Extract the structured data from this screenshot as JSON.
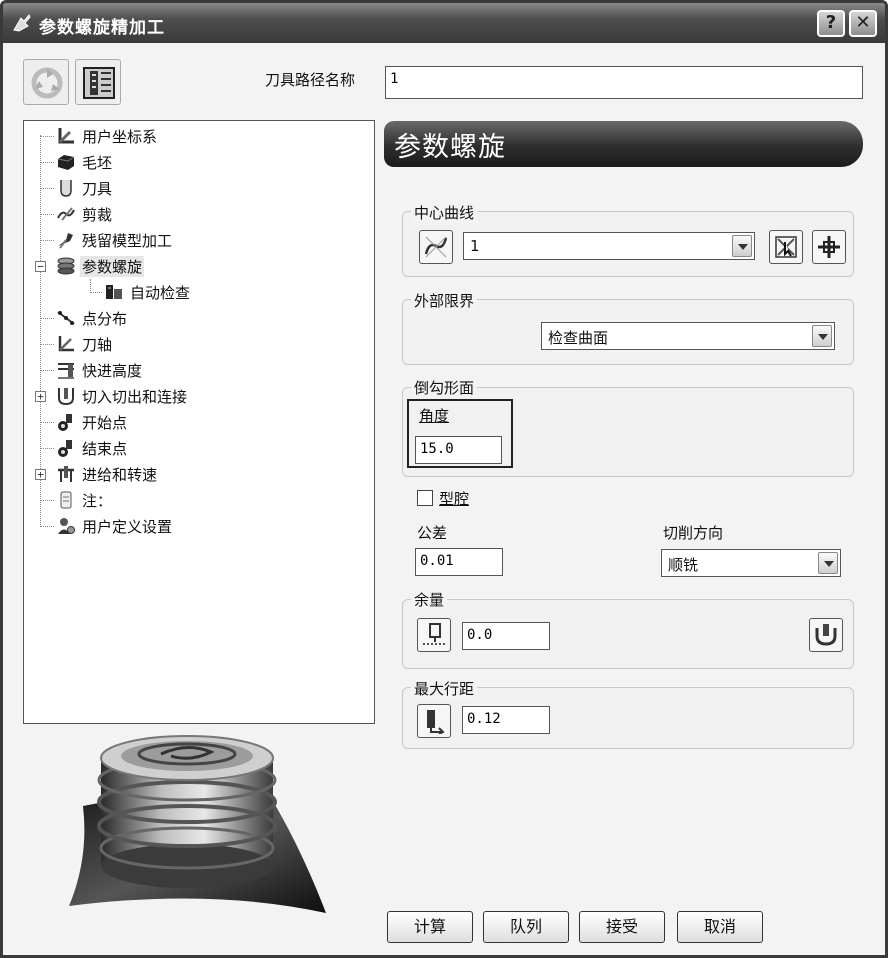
{
  "window": {
    "title": "参数螺旋精加工",
    "help_label": "?",
    "close_label": "✕"
  },
  "toolpath_name": {
    "label": "刀具路径名称",
    "value": "1"
  },
  "tree": {
    "items": [
      {
        "label": "用户坐标系",
        "icon": "ucs-icon"
      },
      {
        "label": "毛坯",
        "icon": "block-icon"
      },
      {
        "label": "刀具",
        "icon": "tool-icon"
      },
      {
        "label": "剪裁",
        "icon": "trim-icon"
      },
      {
        "label": "残留模型加工",
        "icon": "rest-model-icon"
      },
      {
        "label": "参数螺旋",
        "icon": "spiral-icon",
        "selected": true,
        "expander": "−"
      },
      {
        "label": "自动检查",
        "icon": "auto-check-icon"
      },
      {
        "label": "点分布",
        "icon": "point-distribution-icon"
      },
      {
        "label": "刀轴",
        "icon": "tool-axis-icon"
      },
      {
        "label": "快进高度",
        "icon": "rapid-height-icon"
      },
      {
        "label": "切入切出和连接",
        "icon": "leads-links-icon",
        "expander": "+"
      },
      {
        "label": "开始点",
        "icon": "start-point-icon"
      },
      {
        "label": "结束点",
        "icon": "end-point-icon"
      },
      {
        "label": "进给和转速",
        "icon": "feeds-speeds-icon",
        "expander": "+"
      },
      {
        "label": "注：",
        "icon": "notes-icon"
      },
      {
        "label": "用户定义设置",
        "icon": "user-settings-icon"
      }
    ]
  },
  "panel": {
    "title": "参数螺旋",
    "center_curve": {
      "title": "中心曲线",
      "value": "1"
    },
    "outer_limit": {
      "title": "外部限界",
      "value": "检查曲面"
    },
    "undercut": {
      "title": "倒勾形面",
      "angle_label": "角度",
      "angle_value": "15.0"
    },
    "pocket": {
      "label": "型腔",
      "checked": false
    },
    "tolerance": {
      "label": "公差",
      "value": "0.01"
    },
    "cut_direction": {
      "label": "切削方向",
      "value": "顺铣"
    },
    "thickness": {
      "title": "余量",
      "value": "0.0"
    },
    "stepover": {
      "title": "最大行距",
      "value": "0.12"
    }
  },
  "buttons": {
    "calculate": "计算",
    "queue": "队列",
    "accept": "接受",
    "cancel": "取消"
  }
}
